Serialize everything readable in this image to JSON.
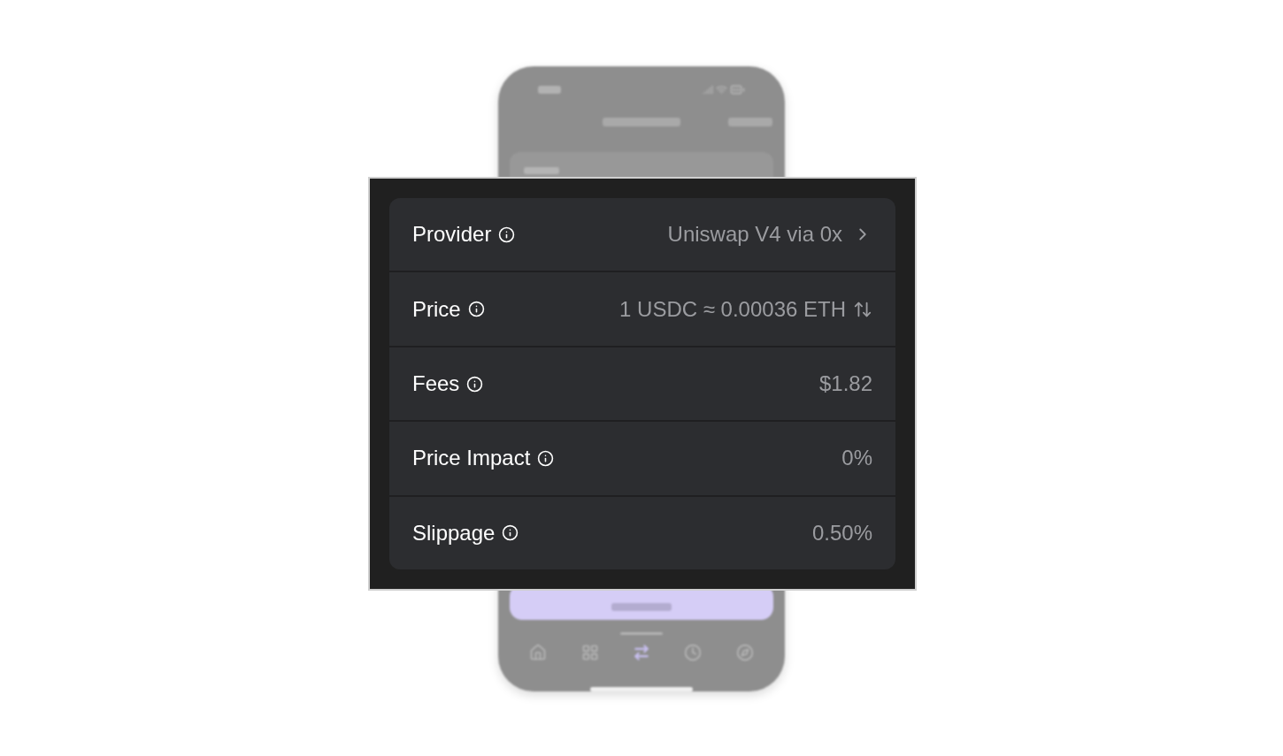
{
  "phone": {
    "tabs": [
      {
        "kind": "home",
        "selected": false
      },
      {
        "kind": "apps",
        "selected": false
      },
      {
        "kind": "swap",
        "selected": true
      },
      {
        "kind": "history",
        "selected": false
      },
      {
        "kind": "explore",
        "selected": false
      }
    ]
  },
  "details": [
    {
      "label": "Provider",
      "value": "Uniswap V4 via 0x",
      "kind": "link"
    },
    {
      "label": "Price",
      "value": "1 USDC ≈ 0.00036 ETH",
      "kind": "toggle"
    },
    {
      "label": "Fees",
      "value": "$1.82",
      "kind": "plain"
    },
    {
      "label": "Price Impact",
      "value": "0%",
      "kind": "plain"
    },
    {
      "label": "Slippage",
      "value": "0.50%",
      "kind": "plain"
    }
  ]
}
